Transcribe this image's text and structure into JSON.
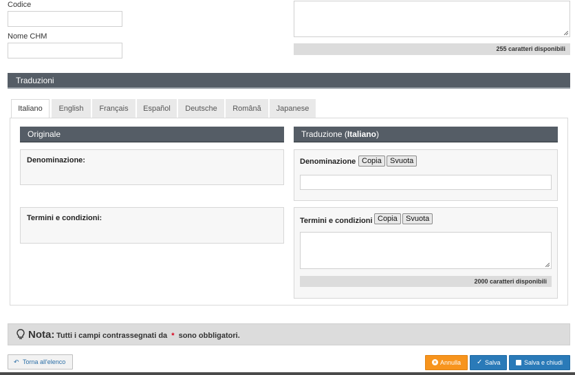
{
  "top": {
    "codice_label": "Codice",
    "nome_label": "Nome CHM",
    "counter_top": "255 caratteri disponibili"
  },
  "section": {
    "title": "Traduzioni"
  },
  "tabs": [
    "Italiano",
    "English",
    "Français",
    "Español",
    "Deutsche",
    "Română",
    "Japanese"
  ],
  "original": {
    "header": "Originale",
    "denominazione_label": "Denominazione:",
    "termini_label": "Termini e condizioni:"
  },
  "translation": {
    "header_prefix": "Traduzione (",
    "header_lang": "Italiano",
    "header_suffix": ")",
    "denominazione_label": "Denominazione",
    "termini_label": "Termini e condizioni",
    "copy_label": "Copia",
    "clear_label": "Svuota",
    "counter": "2000 caratteri disponibili"
  },
  "note": {
    "title": "Nota:",
    "text_before": "Tutti i campi contrassegnati da",
    "asterisk": "*",
    "text_after": "sono obbligatori."
  },
  "footer": {
    "back_label": "Torna all'elenco",
    "cancel_label": "Annulla",
    "save_label": "Salva",
    "save_close_label": "Salva e chiudi"
  },
  "colors": {
    "header_bg": "#555d66",
    "cancel_bg": "#f7941d",
    "save_bg": "#2a7ab8",
    "required": "#d9001b"
  }
}
